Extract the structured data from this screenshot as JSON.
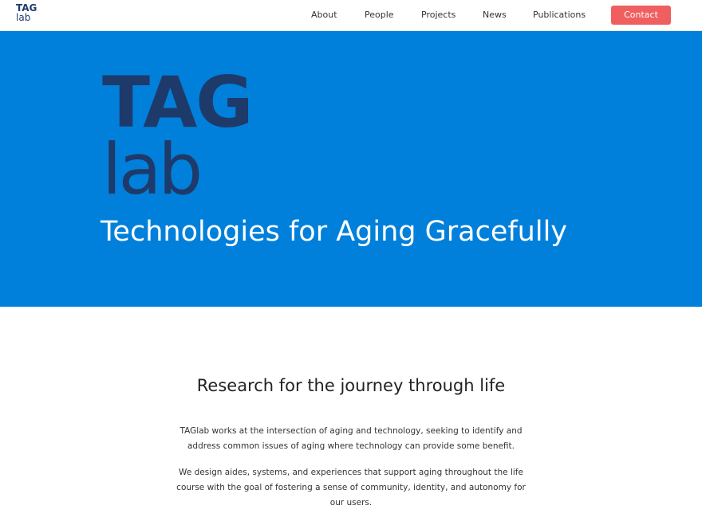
{
  "brand": {
    "line1": "TAG",
    "line2": "lab"
  },
  "nav": {
    "about": "About",
    "people": "People",
    "projects": "Projects",
    "news": "News",
    "publications": "Publications",
    "contact": "Contact"
  },
  "hero": {
    "logo_line1": "TAG",
    "logo_line2": "lab",
    "tagline": "Technologies for Aging Gracefully"
  },
  "intro": {
    "title": "Research for the journey through life",
    "paragraph1": "TAGlab works at the intersection of aging and technology, seeking to identify and address common issues of aging where technology can provide some benefit.",
    "paragraph2": "We design aides, systems, and experiences that support aging throughout the life course with the goal of fostering a sense of community, identity, and autonomy for our users."
  },
  "colors": {
    "hero_background": "#0180db",
    "logo_navy": "#1e3a6b",
    "contact_button": "#f05f5f"
  }
}
